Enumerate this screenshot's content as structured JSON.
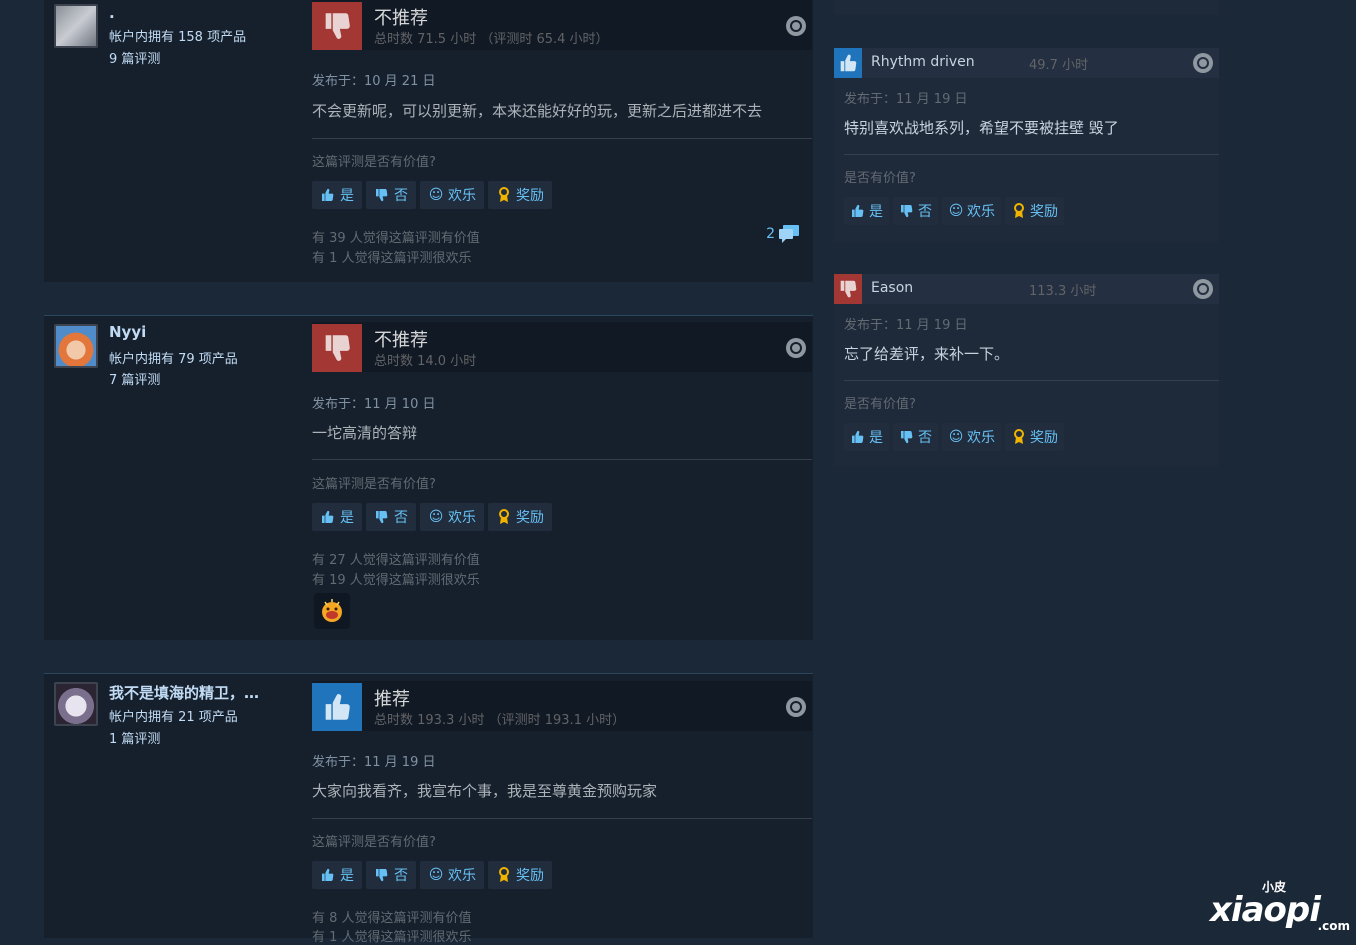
{
  "reviews": [
    {
      "persona": ".",
      "owned": "帐户内拥有 158 项产品",
      "count": "9 篇评测",
      "verdict": "不推荐",
      "hours": "总时数 71.5 小时 （评测时 65.4 小时）",
      "posted": "发布于：10 月 21 日",
      "content": "不会更新呢，可以别更新，本来还能好好的玩，更新之后进都进不去",
      "question": "这篇评测是否有价值?",
      "stat_helpful": "有 39 人觉得这篇评测有价值",
      "stat_funny": "有 1 人觉得这篇评测很欢乐",
      "comments": "2"
    },
    {
      "persona": "Nyyi",
      "owned": "帐户内拥有 79 项产品",
      "count": "7 篇评测",
      "verdict": "不推荐",
      "hours": "总时数 14.0 小时",
      "posted": "发布于：11 月 10 日",
      "content": "一坨高清的答辩",
      "question": "这篇评测是否有价值?",
      "stat_helpful": "有 27 人觉得这篇评测有价值",
      "stat_funny": "有 19 人觉得这篇评测很欢乐"
    },
    {
      "persona": "我不是填海的精卫，…",
      "owned": "帐户内拥有 21 项产品",
      "count": "1 篇评测",
      "verdict": "推荐",
      "hours": "总时数 193.3 小时 （评测时 193.1 小时）",
      "posted": "发布于：11 月 19 日",
      "content": "大家向我看齐，我宣布个事，我是至尊黄金预购玩家",
      "question": "这篇评测是否有价值?",
      "stat_helpful": "有 8 人觉得这篇评测有价值",
      "stat_funny": "有 1 人觉得这篇评测很欢乐"
    }
  ],
  "buttons": {
    "yes": "是",
    "no": "否",
    "funny": "欢乐",
    "award": "奖励"
  },
  "side_reviews": [
    {
      "name": "Rhythm driven",
      "hours": "49.7 小时",
      "posted": "发布于：11 月 19 日",
      "content": "特别喜欢战地系列，希望不要被挂壁 毁了",
      "question": "是否有价值?"
    },
    {
      "name": "Eason",
      "hours": "113.3 小时",
      "posted": "发布于：11 月 19 日",
      "content": "忘了给差评，来补一下。",
      "question": "是否有价值?"
    }
  ],
  "watermark": {
    "top": "小皮",
    "main": "xiaopi",
    "suffix": ".com"
  },
  "icons": {
    "thumb_down": "thumbs-down-icon",
    "thumb_up": "thumbs-up-icon",
    "steam": "steam-logo-icon",
    "smile": "smile-icon",
    "award": "award-ribbon-icon",
    "comment": "comment-bubble-icon"
  },
  "colors": {
    "not_recommended": "#a33734",
    "recommended": "#1f74bc",
    "link": "#66c0f4",
    "award": "#f0b400"
  }
}
